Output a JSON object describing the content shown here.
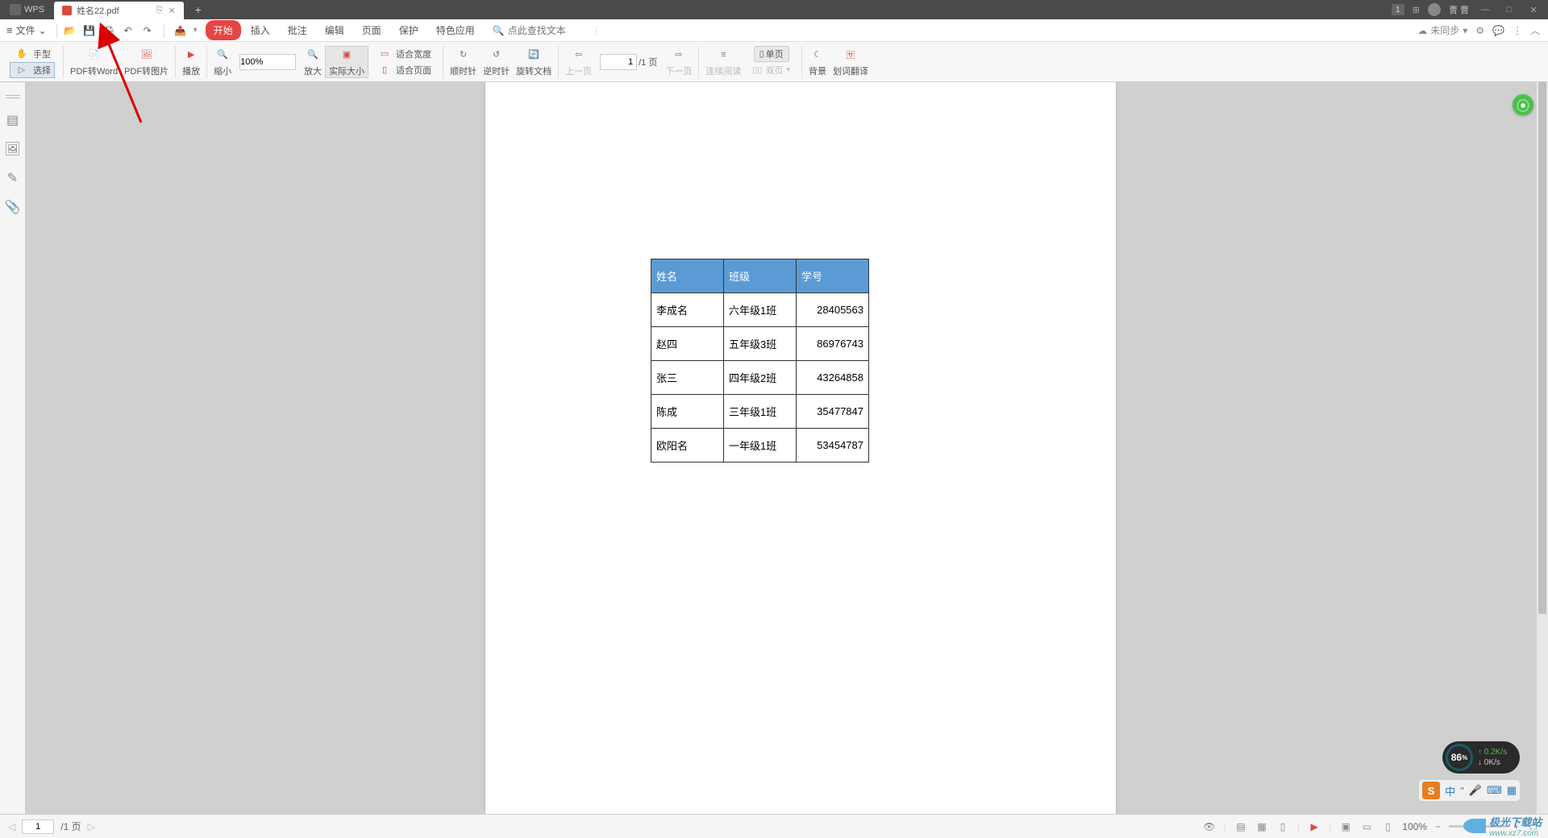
{
  "titleBar": {
    "appName": "WPS",
    "tabName": "姓名22.pdf",
    "notificationBadge": "1",
    "userName": "曹 曹"
  },
  "menuBar": {
    "fileMenu": "文件",
    "tabs": [
      "开始",
      "插入",
      "批注",
      "编辑",
      "页面",
      "保护",
      "特色应用"
    ],
    "searchPlaceholder": "点此查找文本",
    "syncLabel": "未同步"
  },
  "ribbon": {
    "handTool": "手型",
    "selectTool": "选择",
    "pdfToWord": "PDF转Word",
    "pdfToImage": "PDF转图片",
    "play": "播放",
    "zoomOut": "缩小",
    "zoomValue": "100%",
    "zoomIn": "放大",
    "actualSize": "实际大小",
    "fitWidth": "适合宽度",
    "fitPage": "适合页面",
    "clockwise": "顺时针",
    "counterClockwise": "逆时针",
    "rotateDoc": "旋转文档",
    "prevPage": "上一页",
    "pageValue": "1",
    "pageTotal": "/1 页",
    "nextPage": "下一页",
    "continuousRead": "连续阅读",
    "singlePage": "单页",
    "doublePage": "双页",
    "background": "背景",
    "translate": "划词翻译"
  },
  "table": {
    "headers": [
      "姓名",
      "班级",
      "学号"
    ],
    "rows": [
      [
        "李成名",
        "六年级1班",
        "28405563"
      ],
      [
        "赵四",
        "五年级3班",
        "86976743"
      ],
      [
        "张三",
        "四年级2班",
        "43264858"
      ],
      [
        "陈成",
        "三年级1班",
        "35477847"
      ],
      [
        "欧阳名",
        "一年级1班",
        "53454787"
      ]
    ]
  },
  "statusBar": {
    "pageValue": "1",
    "pageTotal": "/1 页",
    "zoomValue": "100%"
  },
  "perf": {
    "percent": "86",
    "up": "0.2K/s",
    "down": "0K/s"
  },
  "ime": {
    "logo": "S",
    "lang": "中"
  },
  "watermark": {
    "text": "极光下载站",
    "url": "www.xz7.com"
  }
}
